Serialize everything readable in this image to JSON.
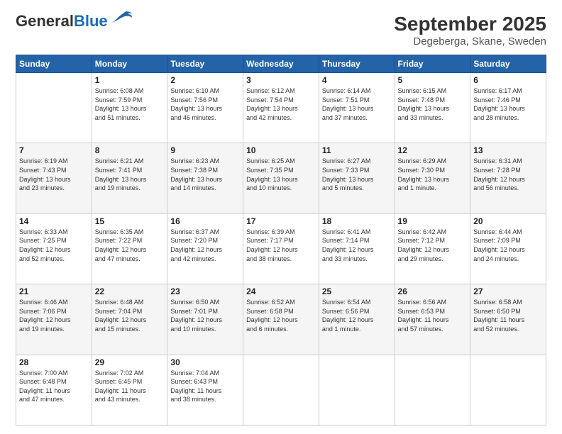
{
  "header": {
    "logo_general": "General",
    "logo_blue": "Blue",
    "title": "September 2025",
    "subtitle": "Degeberga, Skane, Sweden"
  },
  "days_of_week": [
    "Sunday",
    "Monday",
    "Tuesday",
    "Wednesday",
    "Thursday",
    "Friday",
    "Saturday"
  ],
  "weeks": [
    [
      {
        "day": "",
        "info": ""
      },
      {
        "day": "1",
        "info": "Sunrise: 6:08 AM\nSunset: 7:59 PM\nDaylight: 13 hours\nand 51 minutes."
      },
      {
        "day": "2",
        "info": "Sunrise: 6:10 AM\nSunset: 7:56 PM\nDaylight: 13 hours\nand 46 minutes."
      },
      {
        "day": "3",
        "info": "Sunrise: 6:12 AM\nSunset: 7:54 PM\nDaylight: 13 hours\nand 42 minutes."
      },
      {
        "day": "4",
        "info": "Sunrise: 6:14 AM\nSunset: 7:51 PM\nDaylight: 13 hours\nand 37 minutes."
      },
      {
        "day": "5",
        "info": "Sunrise: 6:15 AM\nSunset: 7:48 PM\nDaylight: 13 hours\nand 33 minutes."
      },
      {
        "day": "6",
        "info": "Sunrise: 6:17 AM\nSunset: 7:46 PM\nDaylight: 13 hours\nand 28 minutes."
      }
    ],
    [
      {
        "day": "7",
        "info": "Sunrise: 6:19 AM\nSunset: 7:43 PM\nDaylight: 13 hours\nand 23 minutes."
      },
      {
        "day": "8",
        "info": "Sunrise: 6:21 AM\nSunset: 7:41 PM\nDaylight: 13 hours\nand 19 minutes."
      },
      {
        "day": "9",
        "info": "Sunrise: 6:23 AM\nSunset: 7:38 PM\nDaylight: 13 hours\nand 14 minutes."
      },
      {
        "day": "10",
        "info": "Sunrise: 6:25 AM\nSunset: 7:35 PM\nDaylight: 13 hours\nand 10 minutes."
      },
      {
        "day": "11",
        "info": "Sunrise: 6:27 AM\nSunset: 7:33 PM\nDaylight: 13 hours\nand 5 minutes."
      },
      {
        "day": "12",
        "info": "Sunrise: 6:29 AM\nSunset: 7:30 PM\nDaylight: 13 hours\nand 1 minute."
      },
      {
        "day": "13",
        "info": "Sunrise: 6:31 AM\nSunset: 7:28 PM\nDaylight: 12 hours\nand 56 minutes."
      }
    ],
    [
      {
        "day": "14",
        "info": "Sunrise: 6:33 AM\nSunset: 7:25 PM\nDaylight: 12 hours\nand 52 minutes."
      },
      {
        "day": "15",
        "info": "Sunrise: 6:35 AM\nSunset: 7:22 PM\nDaylight: 12 hours\nand 47 minutes."
      },
      {
        "day": "16",
        "info": "Sunrise: 6:37 AM\nSunset: 7:20 PM\nDaylight: 12 hours\nand 42 minutes."
      },
      {
        "day": "17",
        "info": "Sunrise: 6:39 AM\nSunset: 7:17 PM\nDaylight: 12 hours\nand 38 minutes."
      },
      {
        "day": "18",
        "info": "Sunrise: 6:41 AM\nSunset: 7:14 PM\nDaylight: 12 hours\nand 33 minutes."
      },
      {
        "day": "19",
        "info": "Sunrise: 6:42 AM\nSunset: 7:12 PM\nDaylight: 12 hours\nand 29 minutes."
      },
      {
        "day": "20",
        "info": "Sunrise: 6:44 AM\nSunset: 7:09 PM\nDaylight: 12 hours\nand 24 minutes."
      }
    ],
    [
      {
        "day": "21",
        "info": "Sunrise: 6:46 AM\nSunset: 7:06 PM\nDaylight: 12 hours\nand 19 minutes."
      },
      {
        "day": "22",
        "info": "Sunrise: 6:48 AM\nSunset: 7:04 PM\nDaylight: 12 hours\nand 15 minutes."
      },
      {
        "day": "23",
        "info": "Sunrise: 6:50 AM\nSunset: 7:01 PM\nDaylight: 12 hours\nand 10 minutes."
      },
      {
        "day": "24",
        "info": "Sunrise: 6:52 AM\nSunset: 6:58 PM\nDaylight: 12 hours\nand 6 minutes."
      },
      {
        "day": "25",
        "info": "Sunrise: 6:54 AM\nSunset: 6:56 PM\nDaylight: 12 hours\nand 1 minute."
      },
      {
        "day": "26",
        "info": "Sunrise: 6:56 AM\nSunset: 6:53 PM\nDaylight: 11 hours\nand 57 minutes."
      },
      {
        "day": "27",
        "info": "Sunrise: 6:58 AM\nSunset: 6:50 PM\nDaylight: 11 hours\nand 52 minutes."
      }
    ],
    [
      {
        "day": "28",
        "info": "Sunrise: 7:00 AM\nSunset: 6:48 PM\nDaylight: 11 hours\nand 47 minutes."
      },
      {
        "day": "29",
        "info": "Sunrise: 7:02 AM\nSunset: 6:45 PM\nDaylight: 11 hours\nand 43 minutes."
      },
      {
        "day": "30",
        "info": "Sunrise: 7:04 AM\nSunset: 6:43 PM\nDaylight: 11 hours\nand 38 minutes."
      },
      {
        "day": "",
        "info": ""
      },
      {
        "day": "",
        "info": ""
      },
      {
        "day": "",
        "info": ""
      },
      {
        "day": "",
        "info": ""
      }
    ]
  ]
}
